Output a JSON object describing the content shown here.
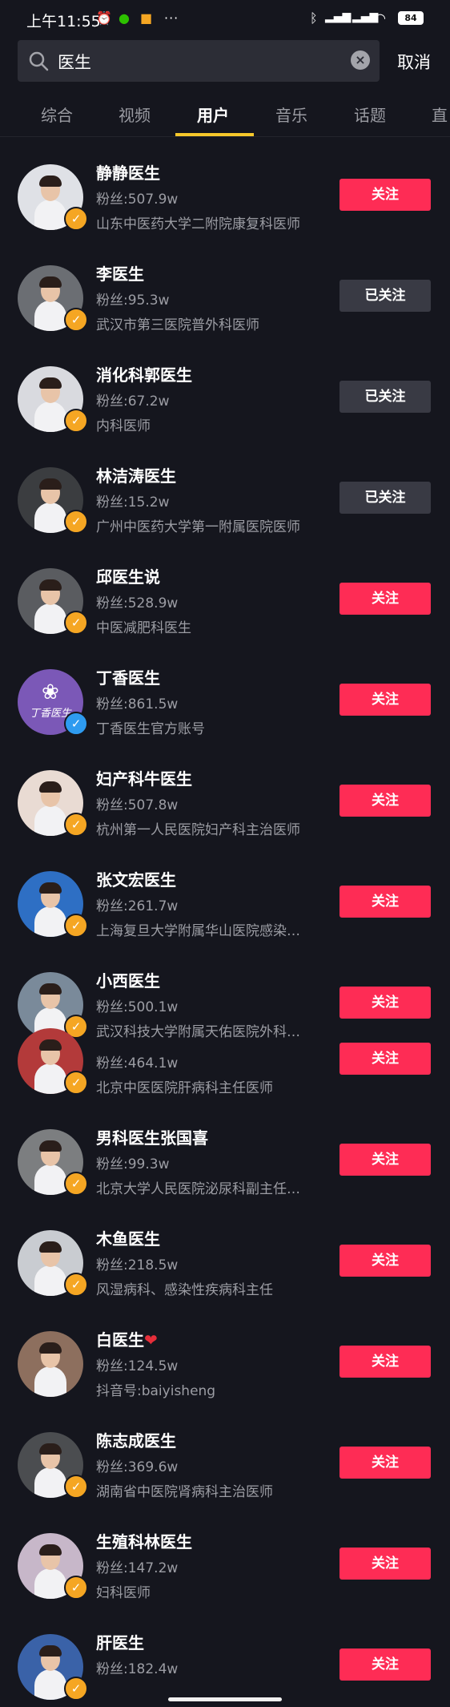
{
  "status_bar": {
    "time": "上午11:55",
    "more": "···",
    "battery": "84"
  },
  "search": {
    "query": "医生",
    "cancel": "取消"
  },
  "tabs": [
    "综合",
    "视频",
    "用户",
    "音乐",
    "话题",
    "直"
  ],
  "active_tab": "用户",
  "users": [
    {
      "name": "静静医生",
      "fans": "粉丝:507.9w",
      "desc": "山东中医药大学二附院康复科医师",
      "button": "关注",
      "followed": false,
      "badge": "orange"
    },
    {
      "name": "李医生",
      "fans": "粉丝:95.3w",
      "desc": "武汉市第三医院普外科医师",
      "button": "已关注",
      "followed": true,
      "badge": "orange"
    },
    {
      "name": "消化科郭医生",
      "fans": "粉丝:67.2w",
      "desc": "内科医师",
      "button": "已关注",
      "followed": true,
      "badge": "orange"
    },
    {
      "name": "林洁涛医生",
      "fans": "粉丝:15.2w",
      "desc": "广州中医药大学第一附属医院医师",
      "button": "已关注",
      "followed": true,
      "badge": "orange"
    },
    {
      "name": "邱医生说",
      "fans": "粉丝:528.9w",
      "desc": "中医减肥科医生",
      "button": "关注",
      "followed": false,
      "badge": "orange"
    },
    {
      "name": "丁香医生",
      "fans": "粉丝:861.5w",
      "desc": "丁香医生官方账号",
      "button": "关注",
      "followed": false,
      "badge": "blue",
      "avatar_text": "丁香医生"
    },
    {
      "name": "妇产科牛医生",
      "fans": "粉丝:507.8w",
      "desc": "杭州第一人民医院妇产科主治医师",
      "button": "关注",
      "followed": false,
      "badge": "orange"
    },
    {
      "name": "张文宏医生",
      "fans": "粉丝:261.7w",
      "desc": "上海复旦大学附属华山医院感染…",
      "button": "关注",
      "followed": false,
      "badge": "orange"
    },
    {
      "name": "小西医生",
      "fans": "粉丝:500.1w",
      "desc": "武汉科技大学附属天佑医院外科…",
      "button": "关注",
      "followed": false,
      "badge": "orange"
    },
    {
      "name": "",
      "fans": "粉丝:464.1w",
      "desc": "北京中医医院肝病科主任医师",
      "button": "关注",
      "followed": false,
      "badge": "orange"
    },
    {
      "name": "男科医生张国喜",
      "fans": "粉丝:99.3w",
      "desc": "北京大学人民医院泌尿科副主任…",
      "button": "关注",
      "followed": false,
      "badge": "orange"
    },
    {
      "name": "木鱼医生",
      "fans": "粉丝:218.5w",
      "desc": "风湿病科、感染性疾病科主任",
      "button": "关注",
      "followed": false,
      "badge": "orange"
    },
    {
      "name": "白医生",
      "name_suffix": "❤",
      "fans": "粉丝:124.5w",
      "desc": "抖音号:baiyisheng",
      "button": "关注",
      "followed": false,
      "badge": "none"
    },
    {
      "name": "陈志成医生",
      "fans": "粉丝:369.6w",
      "desc": "湖南省中医院肾病科主治医师",
      "button": "关注",
      "followed": false,
      "badge": "orange"
    },
    {
      "name": "生殖科林医生",
      "fans": "粉丝:147.2w",
      "desc": "妇科医师",
      "button": "关注",
      "followed": false,
      "badge": "orange"
    },
    {
      "name": "肝医生",
      "fans": "粉丝:182.4w",
      "desc": "",
      "button": "关注",
      "followed": false,
      "badge": "orange"
    }
  ]
}
